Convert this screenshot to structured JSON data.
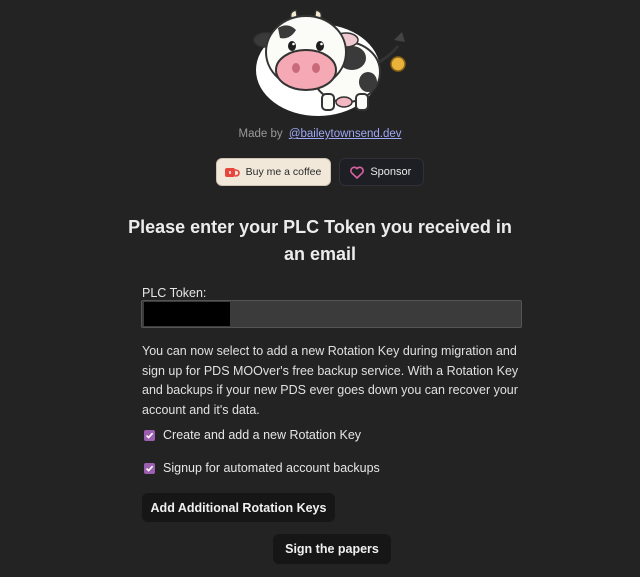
{
  "header": {
    "made_by_prefix": "Made by",
    "author_link": "@baileytownsend.dev",
    "coffee_button": "Buy me a coffee",
    "sponsor_button": "Sponsor"
  },
  "main": {
    "heading": "Please enter your PLC Token you received in an email",
    "token_label": "PLC Token:",
    "token_value": "",
    "info_text": "You can now select to add a new Rotation Key during migration and sign up for PDS MOOver's free backup service. With a Rotation Key and backups if your new PDS ever goes down you can recover your account and it's data.",
    "checkboxes": [
      {
        "label": "Create and add a new Rotation Key",
        "checked": true
      },
      {
        "label": "Signup for automated account backups",
        "checked": true
      }
    ],
    "add_keys_button": "Add Additional Rotation Keys",
    "sign_button": "Sign the papers"
  },
  "colors": {
    "background": "#232323",
    "accent_checkbox": "#9c5fb0",
    "link": "#9fa8f5"
  },
  "icons": [
    "cow-mascot-icon",
    "coffee-cup-icon",
    "heart-icon",
    "checkmark-icon"
  ]
}
